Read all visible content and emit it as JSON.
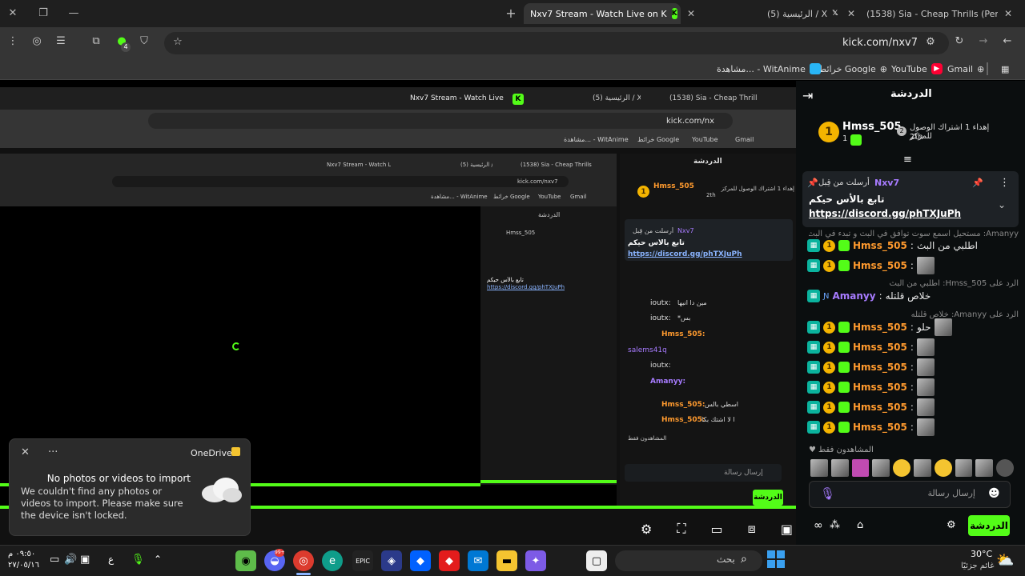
{
  "browser": {
    "tabs": [
      {
        "title": "Nxv7 Stream - Watch Live on K",
        "active": true
      },
      {
        "title": "(5) الرئيسية / X"
      },
      {
        "title": "(1538) Sia - Cheap Thrills (Perfo"
      }
    ],
    "address": "kick.com/nxv7",
    "extension_badge": "4",
    "bookmarks": [
      {
        "label": "Gmail"
      },
      {
        "label": "YouTube"
      },
      {
        "label": "خرائط Google"
      },
      {
        "label": "مشاهدة... - WitAnime"
      }
    ]
  },
  "chat": {
    "header_title": "الدردشة",
    "leaderboard": {
      "user": "Hmss_505",
      "rank_badge": "1",
      "count": "1",
      "second_rank": "2",
      "second_text": "إهداء 1 اشتراك الوصول للمركز",
      "second_place": "2th"
    },
    "pinned": {
      "sender_label": "أرسلت من قِبل",
      "sender": "Nxv7",
      "title": "تابع بالأس حيكم",
      "link": "https://discord.gg/phTXJuPh"
    },
    "messages": [
      {
        "kind": "reply",
        "text": "Amanyy: مستحيل اسمع سوت توافق في البث و تبدء في البث ..."
      },
      {
        "user": "Hmss_505",
        "text": "اطلبي من البث"
      },
      {
        "user": "Hmss_505",
        "text": "",
        "emote": true
      },
      {
        "kind": "reply",
        "text": "الرد على Hmss_505: اطلبي من البث"
      },
      {
        "user": "Amanyy",
        "text": "خلاص قلتله",
        "purple": true
      },
      {
        "kind": "reply",
        "text": "الرد على Amanyy: خلاص قلتله"
      },
      {
        "user": "Hmss_505",
        "text": "حلو",
        "emote": true
      },
      {
        "user": "Hmss_505",
        "text": "",
        "emote": true
      },
      {
        "user": "Hmss_505",
        "text": "",
        "emote": true
      },
      {
        "user": "Hmss_505",
        "text": "",
        "emote": true
      },
      {
        "user": "Hmss_505",
        "text": "",
        "emote": true
      },
      {
        "user": "Hmss_505",
        "text": "",
        "emote": true
      }
    ],
    "supporters_label": "المشاهدون فقط",
    "input_placeholder": "إرسال رسالة",
    "send_label": "الدردشة"
  },
  "nested": {
    "tab1": "Nxv7 Stream - Watch Live on K",
    "tab2": "(5) الرئيسية / X",
    "tab3": "(1538) Sia - Cheap Thrills (Perfo",
    "address": "kick.com/nxv7",
    "bm1": "Gmail",
    "bm2": "YouTube",
    "bm3": "خرائط Google",
    "bm4": "مشاهدة... - WitAnime",
    "chat_title": "الدردشة",
    "user1": "Hmss_505",
    "rank_text": "إهداء 1 اشتراك الوصول للمركز",
    "place": "2th",
    "pinned_label": "أرسلت من قِبل",
    "pinned_sender": "Nxv7",
    "pinned_title": "تابع بالأس حيكم",
    "pinned_link": "https://discord.gg/phTXJuPh",
    "lines": [
      {
        "user": "ioutx:",
        "text": "مين دا انبها"
      },
      {
        "user": "ioutx:",
        "text": "*بس"
      },
      {
        "user": "Hmss_505:",
        "text": ""
      },
      {
        "user": "salems41q",
        "text": ""
      },
      {
        "user": "ioutx:",
        "text": ""
      },
      {
        "user": "Amanyy:",
        "text": ""
      },
      {
        "user": "Hmss_505:",
        "text": "اسطي بالس"
      },
      {
        "user": "Hmss_505:",
        "text": "ا  لا اشتك بكا"
      }
    ],
    "input": "إرسال رسالة",
    "send": "الدردشة",
    "supporters": "المشاهدون فقط"
  },
  "onedrive": {
    "app": "OneDrive",
    "title": "No photos or videos to import",
    "body": "We couldn't find any photos or videos to import. Please make sure the device isn't locked."
  },
  "taskbar": {
    "search_placeholder": "بحث",
    "weather_temp": "30°C",
    "weather_desc": "غائم جزئيًا",
    "time": "٠٩:٥٠ م",
    "date": "٢٧/٠٥/١٦",
    "lang": "ع",
    "discord_badge": "99+"
  },
  "colors": {
    "kick_green": "#53fc18",
    "orange_user": "#ff9a2e",
    "purple_user": "#a77bff",
    "teal_badge": "#0bb39e"
  }
}
